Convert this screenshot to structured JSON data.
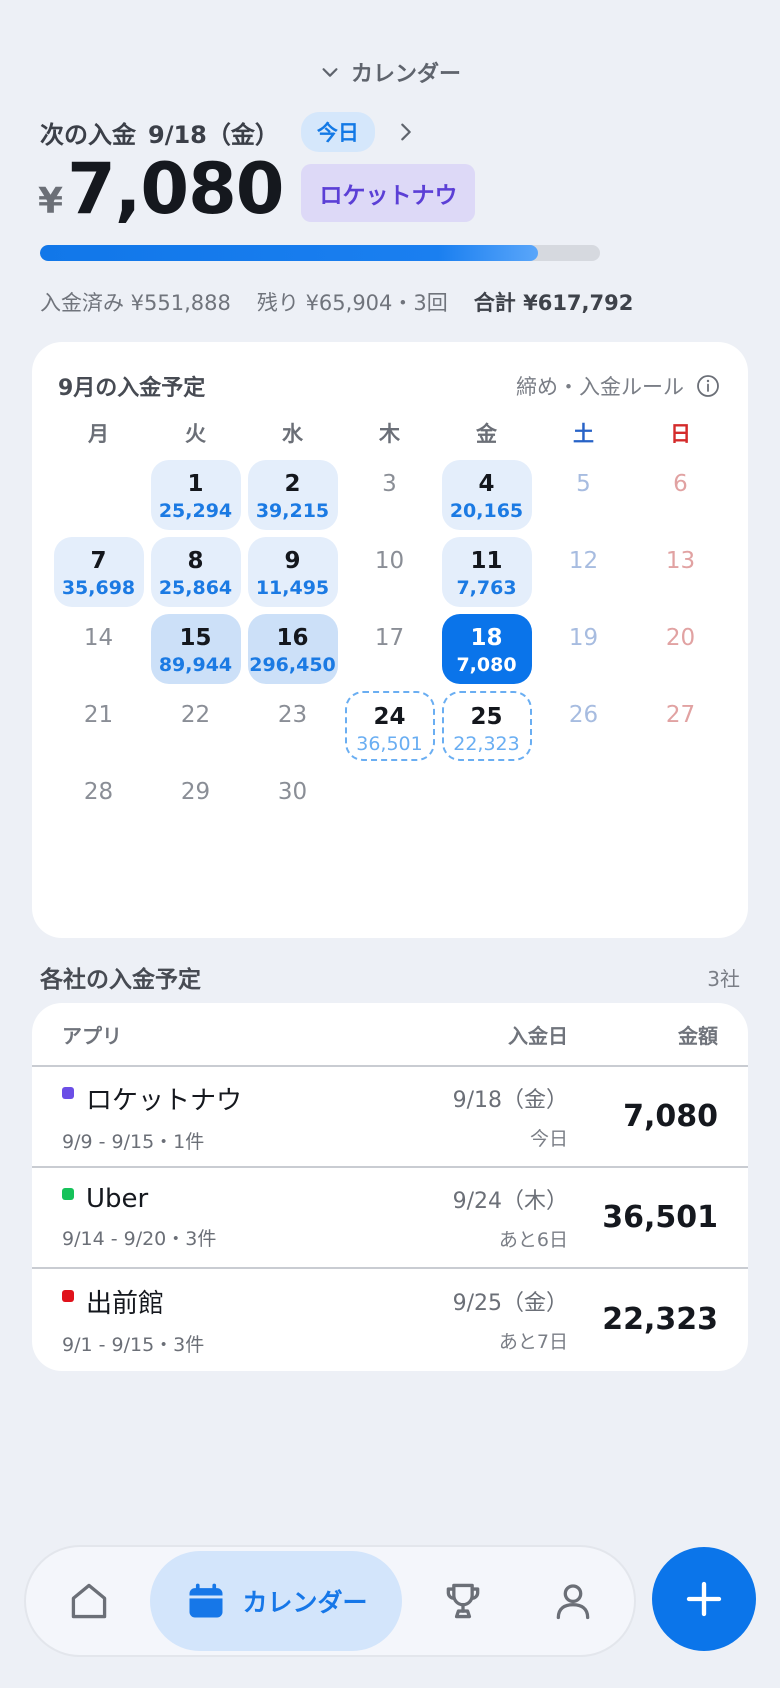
{
  "header": {
    "view_switch_label": "カレンダー",
    "next_payout_label": "次の入金",
    "next_payout_date": "9/18（金）",
    "today_badge": "今日",
    "yen_symbol": "¥",
    "amount": "7,080",
    "app_chip": "ロケットナウ",
    "progress_fraction": 0.889
  },
  "summary": {
    "received": "入金済み ¥551,888",
    "remaining": "残り ¥65,904・3回",
    "total": "合計 ¥617,792"
  },
  "calendar": {
    "title": "9月の入金予定",
    "rule_link": "締め・入金ルール",
    "weekdays": [
      "月",
      "火",
      "水",
      "木",
      "金",
      "土",
      "日"
    ],
    "days": [
      {
        "d": "",
        "v": ""
      },
      {
        "d": "1",
        "v": "25,294"
      },
      {
        "d": "2",
        "v": "39,215"
      },
      {
        "d": "3",
        "v": ""
      },
      {
        "d": "4",
        "v": "20,165"
      },
      {
        "d": "5",
        "v": ""
      },
      {
        "d": "6",
        "v": ""
      },
      {
        "d": "7",
        "v": "35,698"
      },
      {
        "d": "8",
        "v": "25,864"
      },
      {
        "d": "9",
        "v": "11,495"
      },
      {
        "d": "10",
        "v": ""
      },
      {
        "d": "11",
        "v": "7,763"
      },
      {
        "d": "12",
        "v": ""
      },
      {
        "d": "13",
        "v": ""
      },
      {
        "d": "14",
        "v": ""
      },
      {
        "d": "15",
        "v": "89,944"
      },
      {
        "d": "16",
        "v": "296,450"
      },
      {
        "d": "17",
        "v": ""
      },
      {
        "d": "18",
        "v": "7,080"
      },
      {
        "d": "19",
        "v": ""
      },
      {
        "d": "20",
        "v": ""
      },
      {
        "d": "21",
        "v": ""
      },
      {
        "d": "22",
        "v": ""
      },
      {
        "d": "23",
        "v": ""
      },
      {
        "d": "24",
        "v": "36,501"
      },
      {
        "d": "25",
        "v": "22,323"
      },
      {
        "d": "26",
        "v": ""
      },
      {
        "d": "27",
        "v": ""
      },
      {
        "d": "28",
        "v": ""
      },
      {
        "d": "29",
        "v": ""
      },
      {
        "d": "30",
        "v": ""
      }
    ]
  },
  "companies": {
    "title": "各社の入金予定",
    "count": "3社",
    "headers": {
      "app": "アプリ",
      "date": "入金日",
      "amount": "金額"
    },
    "rows": [
      {
        "name": "ロケットナウ",
        "color": "#6b4ee6",
        "period": "9/9 - 9/15・1件",
        "date": "9/18（金）",
        "date_sub": "今日",
        "amount": "7,080"
      },
      {
        "name": "Uber",
        "color": "#16c25a",
        "period": "9/14 - 9/20・3件",
        "date": "9/24（木）",
        "date_sub": "あと6日",
        "amount": "36,501"
      },
      {
        "name": "出前館",
        "color": "#e0121b",
        "period": "9/1 - 9/15・3件",
        "date": "9/25（金）",
        "date_sub": "あと7日",
        "amount": "22,323"
      }
    ]
  },
  "nav": {
    "home_icon": "home-icon",
    "calendar_label": "カレンダー",
    "trophy_icon": "trophy-icon",
    "user_icon": "user-icon",
    "fab_icon": "plus-icon",
    "accent_color": "#0b75ea"
  }
}
